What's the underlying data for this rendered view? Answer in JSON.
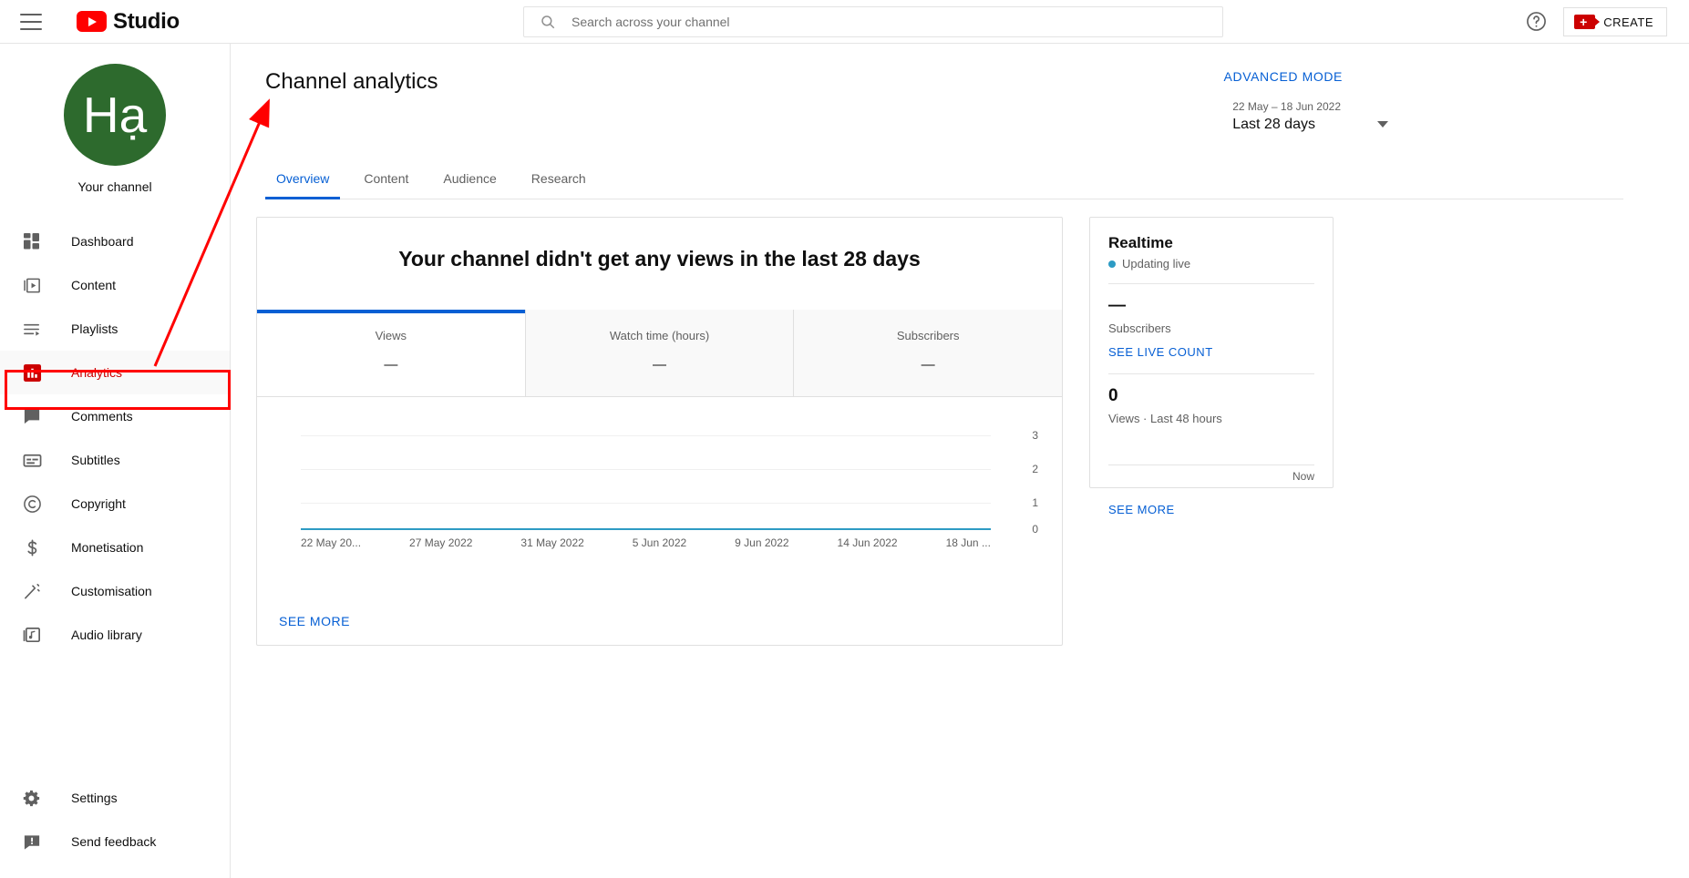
{
  "topbar": {
    "menu_icon": "hamburger-icon",
    "brand": "Studio",
    "search_placeholder": "Search across your channel",
    "search_value": "",
    "help_icon": "help-circle-icon",
    "create_label": "CREATE",
    "create_icon": "video-camera-plus-icon"
  },
  "sidebar": {
    "avatar_initials": "Hạ",
    "avatar_color": "#2d6a2d",
    "channel_label": "Your channel",
    "items": [
      {
        "label": "Dashboard",
        "icon": "dashboard-icon"
      },
      {
        "label": "Content",
        "icon": "video-play-icon"
      },
      {
        "label": "Playlists",
        "icon": "playlist-icon"
      },
      {
        "label": "Analytics",
        "icon": "bar-chart-icon",
        "active": true
      },
      {
        "label": "Comments",
        "icon": "comment-icon"
      },
      {
        "label": "Subtitles",
        "icon": "subtitles-icon"
      },
      {
        "label": "Copyright",
        "icon": "copyright-icon"
      },
      {
        "label": "Monetisation",
        "icon": "dollar-icon"
      },
      {
        "label": "Customisation",
        "icon": "magic-wand-icon"
      },
      {
        "label": "Audio library",
        "icon": "music-note-icon"
      }
    ],
    "bottom_items": [
      {
        "label": "Settings",
        "icon": "gear-icon"
      },
      {
        "label": "Send feedback",
        "icon": "feedback-icon"
      }
    ]
  },
  "main": {
    "page_title": "Channel analytics",
    "advanced_mode": "ADVANCED MODE",
    "date_range": "22 May – 18 Jun 2022",
    "date_label": "Last 28 days",
    "tabs": [
      {
        "label": "Overview",
        "active": true
      },
      {
        "label": "Content",
        "active": false
      },
      {
        "label": "Audience",
        "active": false
      },
      {
        "label": "Research",
        "active": false
      }
    ],
    "card_heading": "Your channel didn't get any views in the last 28 days",
    "metric_tabs": [
      {
        "name": "Views",
        "value": "—",
        "active": true
      },
      {
        "name": "Watch time (hours)",
        "value": "—",
        "active": false
      },
      {
        "name": "Subscribers",
        "value": "—",
        "active": false
      }
    ],
    "see_more": "SEE MORE"
  },
  "realtime": {
    "title": "Realtime",
    "live_text": "Updating live",
    "subscribers_value": "—",
    "subscribers_label": "Subscribers",
    "see_live_count": "SEE LIVE COUNT",
    "views_value": "0",
    "views_label": "Views · Last 48 hours",
    "now_label": "Now",
    "see_more": "SEE MORE",
    "accent_color": "#2d9bc4"
  },
  "annotations": {
    "highlight_target": "Analytics",
    "highlight_color": "#ff0000",
    "arrow_from": "analytics-sidebar-item",
    "arrow_to": "channel-analytics-title"
  },
  "chart_data": {
    "type": "line",
    "title": "Views",
    "xlabel": "",
    "ylabel": "",
    "ylim": [
      0,
      3
    ],
    "yticks": [
      "0",
      "1",
      "2",
      "3"
    ],
    "xticks": [
      "22 May 20...",
      "27 May 2022",
      "31 May 2022",
      "5 Jun 2022",
      "9 Jun 2022",
      "14 Jun 2022",
      "18 Jun ..."
    ],
    "grid": true,
    "legend": "none",
    "line_color": "#2d9bc4",
    "series": [
      {
        "name": "Views",
        "x": [
          "22 May 2022",
          "27 May 2022",
          "31 May 2022",
          "5 Jun 2022",
          "9 Jun 2022",
          "14 Jun 2022",
          "18 Jun 2022"
        ],
        "values": [
          0,
          0,
          0,
          0,
          0,
          0,
          0
        ]
      }
    ]
  }
}
